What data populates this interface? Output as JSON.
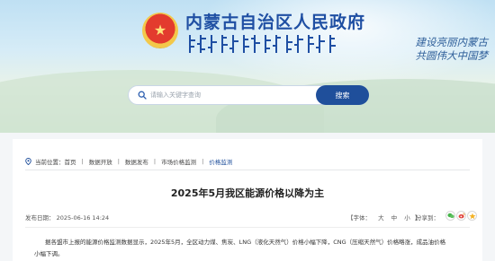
{
  "header": {
    "site_title": "内蒙古自治区人民政府",
    "emblem_symbol": "★",
    "slogan_line1": "建设亮丽内蒙古",
    "slogan_line2": "共圆伟大中国梦"
  },
  "search": {
    "placeholder": "请输入关键字查询",
    "button_label": "搜索"
  },
  "breadcrumb": {
    "prefix": "当前位置：",
    "items": [
      "首页",
      "数据开放",
      "数据发布",
      "市场价格监测",
      "价格监测"
    ],
    "separator": "|"
  },
  "article": {
    "title": "2025年5月我区能源价格以降为主",
    "published_label": "发布日期：",
    "published_date": "2025-06-16 14:24",
    "font_size_label": "【字体：",
    "font_size_options": [
      "大",
      "中",
      "小"
    ],
    "font_size_close": "】",
    "share_label": "分享到：",
    "body_line1": "据各盟市上报的能源价格监测数据显示，2025年5月，全区动力煤、焦炭、LNG（液化天然气）价格小幅下降，CNG（压缩天然气）价格略涨，成品油价格",
    "body_line2": "小幅下调。"
  },
  "colors": {
    "primary_blue": "#1f4f9b",
    "title_blue": "#1f4fa3",
    "emblem_red": "#e33b2e",
    "emblem_gold": "#f3c84a"
  },
  "icons": [
    "emblem-icon",
    "search-icon",
    "location-icon",
    "wechat-icon",
    "weibo-icon",
    "qzone-icon"
  ]
}
